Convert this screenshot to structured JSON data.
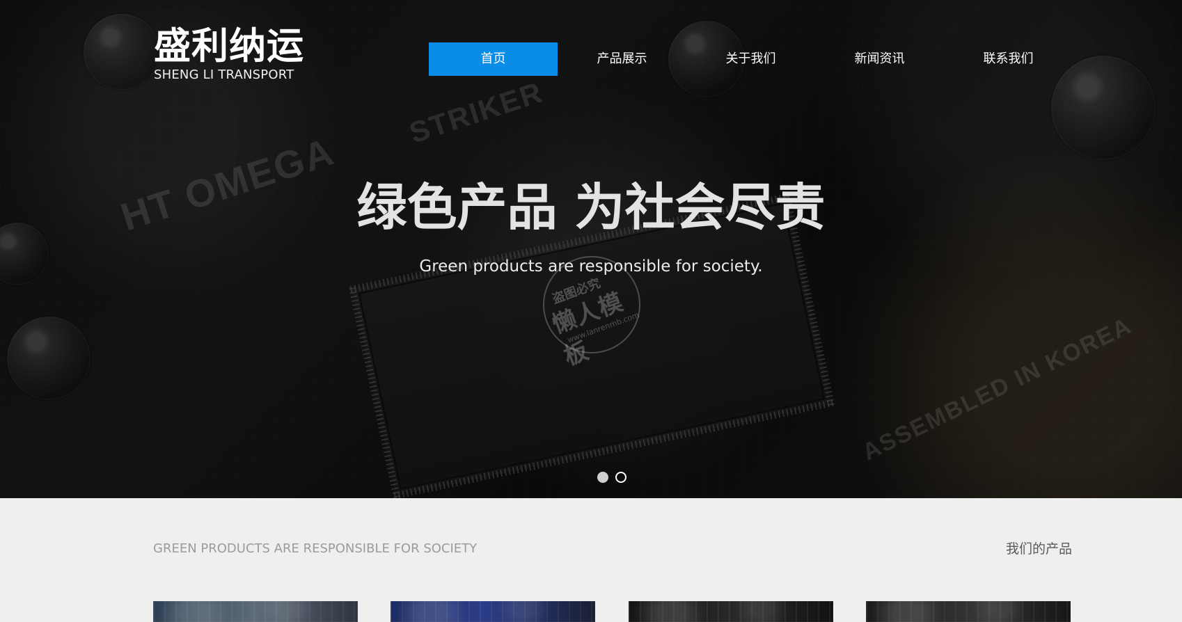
{
  "header": {
    "logo_cn": "盛利纳运",
    "logo_en": "SHENG LI TRANSPORT"
  },
  "nav": {
    "items": [
      {
        "label": "首页",
        "active": true
      },
      {
        "label": "产品展示",
        "active": false
      },
      {
        "label": "关于我们",
        "active": false
      },
      {
        "label": "新闻资讯",
        "active": false
      },
      {
        "label": "联系我们",
        "active": false
      }
    ]
  },
  "hero": {
    "title": "绿色产品 为社会尽责",
    "subtitle": "Green products are responsible for society.",
    "watermark": {
      "top": "盗图必究",
      "main": "懒人模板",
      "url": "www.lanrenmb.com"
    },
    "dots": [
      {
        "active": true
      },
      {
        "active": false
      }
    ]
  },
  "section": {
    "left_text": "GREEN PRODUCTS ARE RESPONSIBLE FOR SOCIETY",
    "right_text": "我们的产品"
  },
  "colors": {
    "accent": "#0a8de6",
    "hero_text": "#e3e3e3",
    "section_bg": "#efefef"
  }
}
